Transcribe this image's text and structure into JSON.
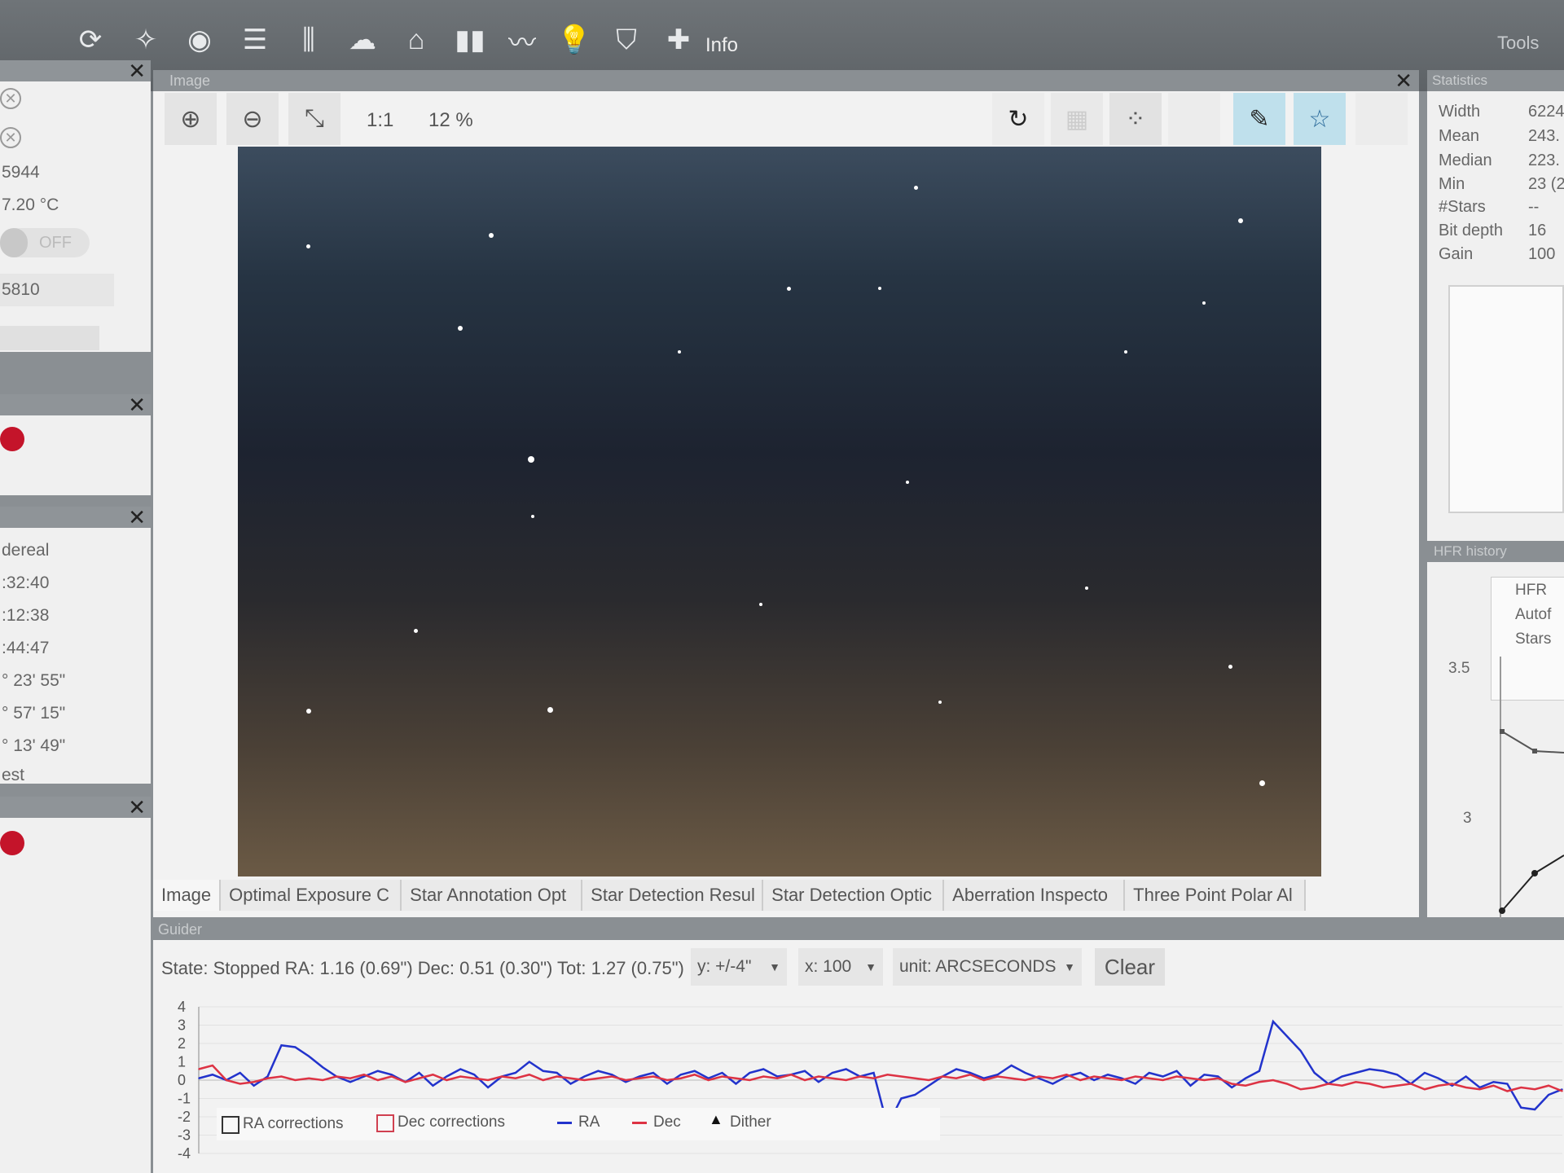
{
  "toolbar": {
    "info_label": "Info",
    "tools_label": "Tools",
    "icons": [
      "refresh-icon",
      "telescope-icon",
      "target-icon",
      "list-icon",
      "sliders-icon",
      "cloud-icon",
      "dome-icon",
      "bar-chart-icon",
      "line-chart-icon",
      "bulb-icon",
      "shield-icon",
      "puzzle-icon"
    ]
  },
  "left_panel": {
    "camera": {
      "value1": "5944",
      "temp": "7.20 °C",
      "toggle": "OFF",
      "value2": "5810"
    },
    "sky": {
      "label": "dereal",
      "times": [
        ":32:40",
        ":12:38",
        ":44:47"
      ],
      "angles": [
        "° 23' 55\"",
        "° 57' 15\"",
        "° 13' 49\""
      ],
      "footer": "est"
    }
  },
  "image_panel": {
    "title": "Image",
    "zoom_ratio": "1:1",
    "zoom_percent": "12 %",
    "tabs": [
      "Image",
      "Optimal Exposure C",
      "Star Annotation Opt",
      "Star Detection Resul",
      "Star Detection Optic",
      "Aberration Inspecto",
      "Three Point Polar Al"
    ]
  },
  "statistics": {
    "title": "Statistics",
    "rows": [
      {
        "label": "Width",
        "value": "6224"
      },
      {
        "label": "Mean",
        "value": "243."
      },
      {
        "label": "Median",
        "value": "223."
      },
      {
        "label": "Min",
        "value": "23 (2"
      },
      {
        "label": "#Stars",
        "value": "--"
      },
      {
        "label": "Bit depth",
        "value": "16"
      },
      {
        "label": "Gain",
        "value": "100"
      }
    ]
  },
  "hfr_history": {
    "title": "HFR history",
    "legend": [
      "HFR",
      "Autof",
      "Stars"
    ],
    "y_ticks": [
      "3.5",
      "3"
    ]
  },
  "guider": {
    "title": "Guider",
    "state": "State: Stopped  RA: 1.16 (0.69\")  Dec: 0.51 (0.30\")  Tot: 1.27 (0.75\")",
    "y_scale": "y: +/-4\"",
    "x_scale": "x: 100",
    "unit": "unit: ARCSECONDS",
    "clear_label": "Clear",
    "legend": {
      "ra_corr": "RA corrections",
      "dec_corr": "Dec corrections",
      "ra": "RA",
      "dec": "Dec",
      "dither": "Dither"
    }
  },
  "chart_data": {
    "type": "line",
    "ylim": [
      -4,
      4
    ],
    "y_ticks": [
      4,
      3,
      2,
      1,
      0,
      -1,
      -2,
      -3,
      -4
    ],
    "x": [
      0,
      1,
      2,
      3,
      4,
      5,
      6,
      7,
      8,
      9,
      10,
      11,
      12,
      13,
      14,
      15,
      16,
      17,
      18,
      19,
      20,
      21,
      22,
      23,
      24,
      25,
      26,
      27,
      28,
      29,
      30,
      31,
      32,
      33,
      34,
      35,
      36,
      37,
      38,
      39,
      40,
      41,
      42,
      43,
      44,
      45,
      46,
      47,
      48,
      49,
      50,
      51,
      52,
      53,
      54,
      55,
      56,
      57,
      58,
      59,
      60,
      61,
      62,
      63,
      64,
      65,
      66,
      67,
      68,
      69,
      70,
      71,
      72,
      73,
      74,
      75,
      76,
      77,
      78,
      79,
      80,
      81,
      82,
      83,
      84,
      85,
      86,
      87,
      88,
      89,
      90,
      91,
      92,
      93,
      94,
      95,
      96,
      97,
      98,
      99
    ],
    "series": [
      {
        "name": "RA",
        "color": "#2233cc",
        "values": [
          0.1,
          0.3,
          0,
          0.4,
          -0.3,
          0.2,
          1.9,
          1.8,
          1.3,
          0.7,
          0.2,
          -0.1,
          0.2,
          0.5,
          0.3,
          -0.1,
          0.4,
          -0.3,
          0.2,
          0.6,
          0.3,
          -0.4,
          0.2,
          0.4,
          1.0,
          0.5,
          0.4,
          -0.2,
          0.2,
          0.5,
          0.3,
          -0.1,
          0.2,
          0.4,
          -0.2,
          0.3,
          0.5,
          0.1,
          0.4,
          -0.2,
          0.4,
          0.6,
          0.2,
          0.3,
          0.5,
          -0.1,
          0.4,
          0.6,
          0.2,
          0.4,
          -2.5,
          -1.0,
          -0.8,
          -0.3,
          0.2,
          0.6,
          0.4,
          0.1,
          0.3,
          0.8,
          0.4,
          0.1,
          -0.2,
          0.2,
          0.4,
          0.0,
          0.3,
          0.1,
          -0.2,
          0.4,
          0.2,
          0.5,
          -0.3,
          0.3,
          0.2,
          -0.4,
          0.1,
          0.5,
          3.2,
          2.4,
          1.6,
          0.4,
          -0.2,
          0.2,
          0.4,
          0.6,
          0.5,
          0.3,
          -0.2,
          0.4,
          0.1,
          -0.3,
          0.2,
          -0.4,
          -0.1,
          -0.2,
          -1.5,
          -1.6,
          -0.8,
          -0.5
        ]
      },
      {
        "name": "Dec",
        "color": "#dd3344",
        "values": [
          0.6,
          0.8,
          0.0,
          -0.2,
          -0.1,
          0.1,
          0.2,
          0.0,
          0.1,
          0.0,
          0.2,
          0.1,
          0.3,
          0.0,
          0.2,
          -0.1,
          0.1,
          0.3,
          0.0,
          0.2,
          0.1,
          0.0,
          0.2,
          0.1,
          0.3,
          0.0,
          0.2,
          0.1,
          0.0,
          0.1,
          0.2,
          0.0,
          0.1,
          0.2,
          0.0,
          0.1,
          0.3,
          0.0,
          0.2,
          0.1,
          0.0,
          0.2,
          0.1,
          0.3,
          0.0,
          0.2,
          0.1,
          0.0,
          0.2,
          0.1,
          0.3,
          0.2,
          0.1,
          0.0,
          0.2,
          0.1,
          0.3,
          0.0,
          0.2,
          0.1,
          0.0,
          0.2,
          0.1,
          0.3,
          0.0,
          0.2,
          0.1,
          0.0,
          0.2,
          0.1,
          0.0,
          0.2,
          0.1,
          0.0,
          0.1,
          -0.2,
          -0.3,
          -0.1,
          0.0,
          -0.2,
          -0.5,
          -0.4,
          -0.2,
          -0.3,
          -0.1,
          -0.2,
          -0.4,
          -0.3,
          -0.2,
          -0.5,
          -0.3,
          -0.2,
          -0.4,
          -0.5,
          -0.3,
          -0.6,
          -0.4,
          -0.5,
          -0.3,
          -0.6
        ]
      }
    ]
  }
}
